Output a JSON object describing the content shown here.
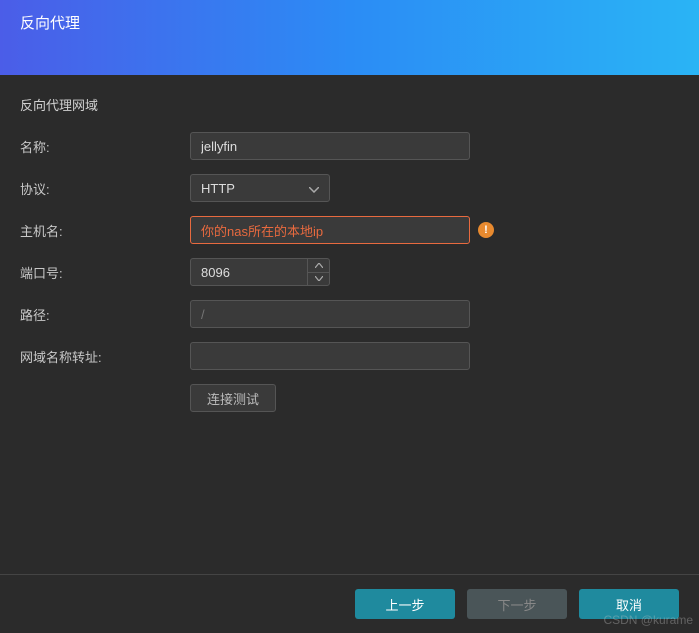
{
  "header": {
    "title": "反向代理"
  },
  "section": {
    "title": "反向代理网域"
  },
  "form": {
    "name": {
      "label": "名称:",
      "value": "jellyfin"
    },
    "protocol": {
      "label": "协议:",
      "value": "HTTP"
    },
    "hostname": {
      "label": "主机名:",
      "value": "你的nas所在的本地ip"
    },
    "port": {
      "label": "端口号:",
      "value": "8096"
    },
    "path": {
      "label": "路径:",
      "placeholder": "/"
    },
    "redirect": {
      "label": "网域名称转址:",
      "value": ""
    },
    "test": {
      "label": "连接测试"
    }
  },
  "footer": {
    "prev": "上一步",
    "next": "下一步",
    "cancel": "取消"
  },
  "watermark": "CSDN @kurame"
}
